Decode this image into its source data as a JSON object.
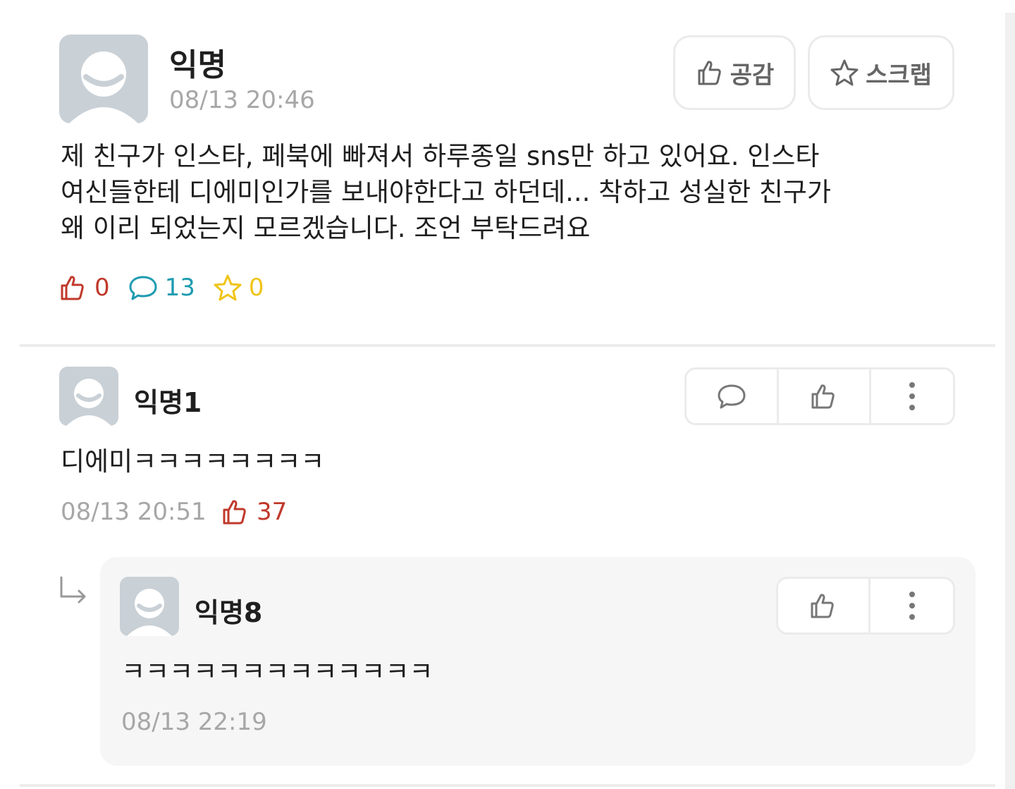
{
  "post": {
    "author": "익명",
    "timestamp": "08/13 20:46",
    "body": "제 친구가 인스타, 페북에 빠져서 하루종일 sns만 하고 있어요. 인스타\n여신들한테 디에미인가를 보내야한다고 하던데... 착하고 성실한 친구가\n왜 이리 되었는지 모르겠습니다. 조언 부탁드려요",
    "like_button_label": "공감",
    "scrap_button_label": "스크랩",
    "stats": {
      "likes": "0",
      "comments": "13",
      "scraps": "0"
    },
    "colors": {
      "likes": "#c0392b",
      "comments": "#1e9bb0",
      "scraps": "#f0c419"
    }
  },
  "comments": [
    {
      "author": "익명1",
      "body": "디에미ㅋㅋㅋㅋㅋㅋㅋㅋ",
      "timestamp": "08/13 20:51",
      "likes": "37",
      "replies": [
        {
          "author": "익명8",
          "body": "ㅋㅋㅋㅋㅋㅋㅋㅋㅋㅋㅋㅋㅋ",
          "timestamp": "08/13 22:19"
        }
      ]
    }
  ],
  "icons": {
    "avatar": "default-avatar-icon",
    "like": "thumbs-up-icon",
    "scrap": "star-icon",
    "comment": "speech-bubble-icon",
    "more": "more-vertical-icon",
    "reply": "reply-arrow-icon"
  }
}
